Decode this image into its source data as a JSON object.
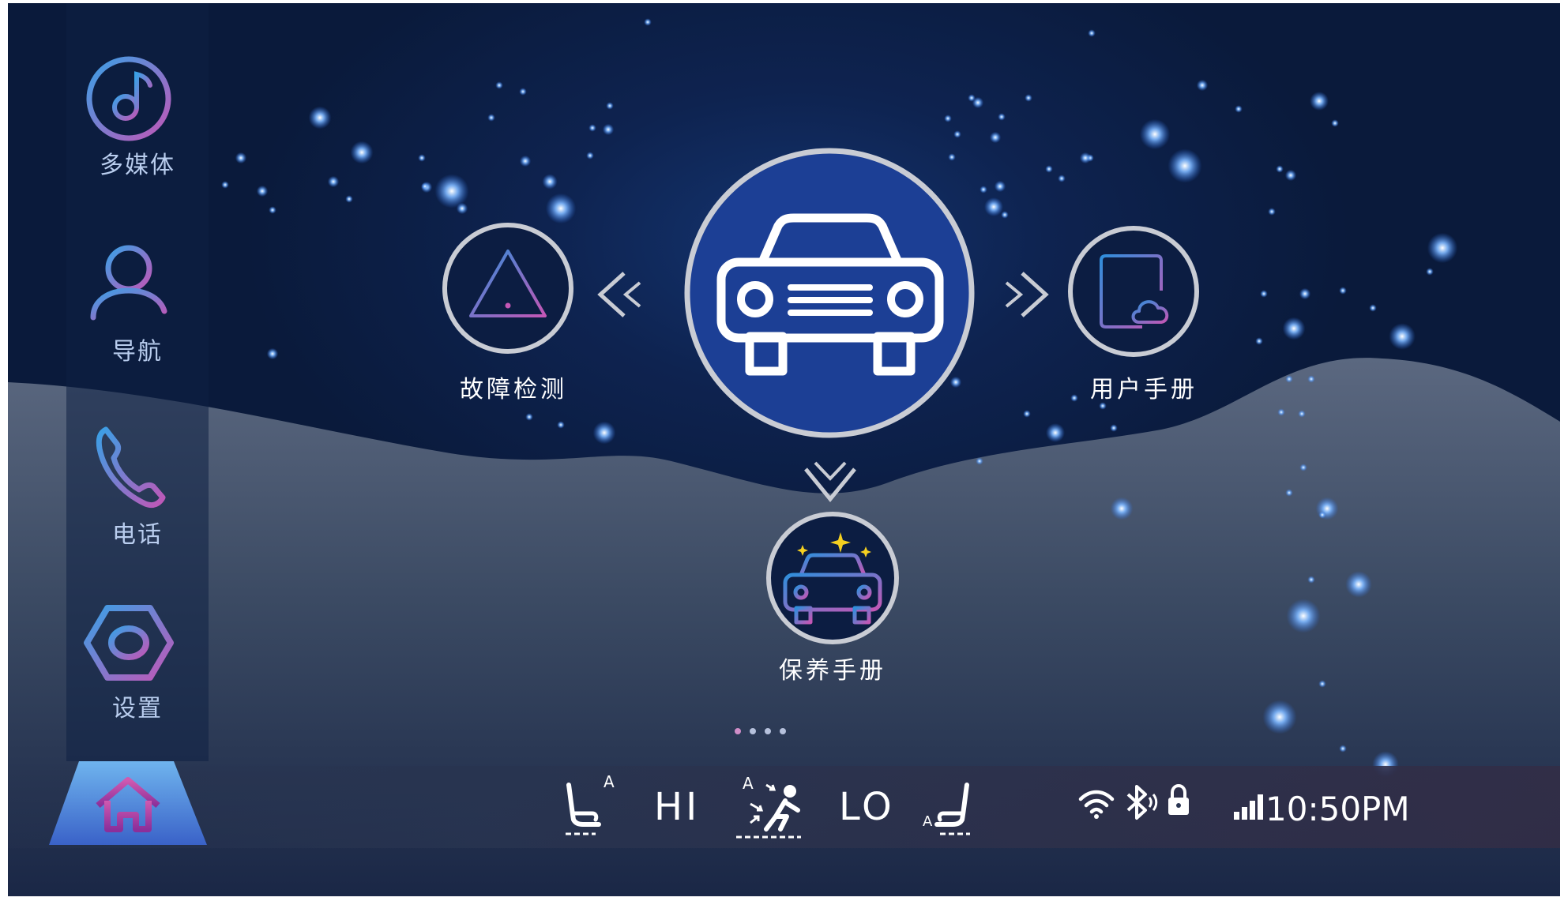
{
  "sidebar": {
    "items": [
      {
        "label": "多媒体",
        "icon": "music-note-icon"
      },
      {
        "label": "导航",
        "icon": "user-icon"
      },
      {
        "label": "电话",
        "icon": "phone-icon"
      },
      {
        "label": "设置",
        "icon": "hexagon-settings-icon"
      }
    ]
  },
  "main": {
    "center": {
      "icon": "car-front-icon"
    },
    "left": {
      "label": "故障检测",
      "icon": "warning-triangle-icon"
    },
    "right": {
      "label": "用户手册",
      "icon": "document-cloud-icon"
    },
    "bottom": {
      "label": "保养手册",
      "icon": "sparkling-car-icon"
    },
    "page_indicator": {
      "count": 4,
      "active": 1
    }
  },
  "statusbar": {
    "home_icon": "home-icon",
    "left_seat_icon": "seat-heat-left-icon",
    "left_seat_mode": "A",
    "fan_high": "HI",
    "airflow_icon": "airflow-person-icon",
    "airflow_mode": "A",
    "fan_low": "LO",
    "right_seat_icon": "seat-heat-right-icon",
    "right_seat_mode": "A",
    "wifi_icon": "wifi-icon",
    "bluetooth_icon": "bluetooth-icon",
    "lock_icon": "lock-icon",
    "signal_icon": "signal-bars-icon",
    "time": "10:50PM"
  },
  "colors": {
    "background": "#0a1a3b",
    "hill": "#3f4e66",
    "center_circle": "#1c3f95",
    "ring": "#c9ccd4",
    "accent_blue": "#3a8fd8",
    "accent_pink": "#c054b8",
    "active_dot": "#d08ec8",
    "inactive_dot": "#b6c1dc"
  }
}
